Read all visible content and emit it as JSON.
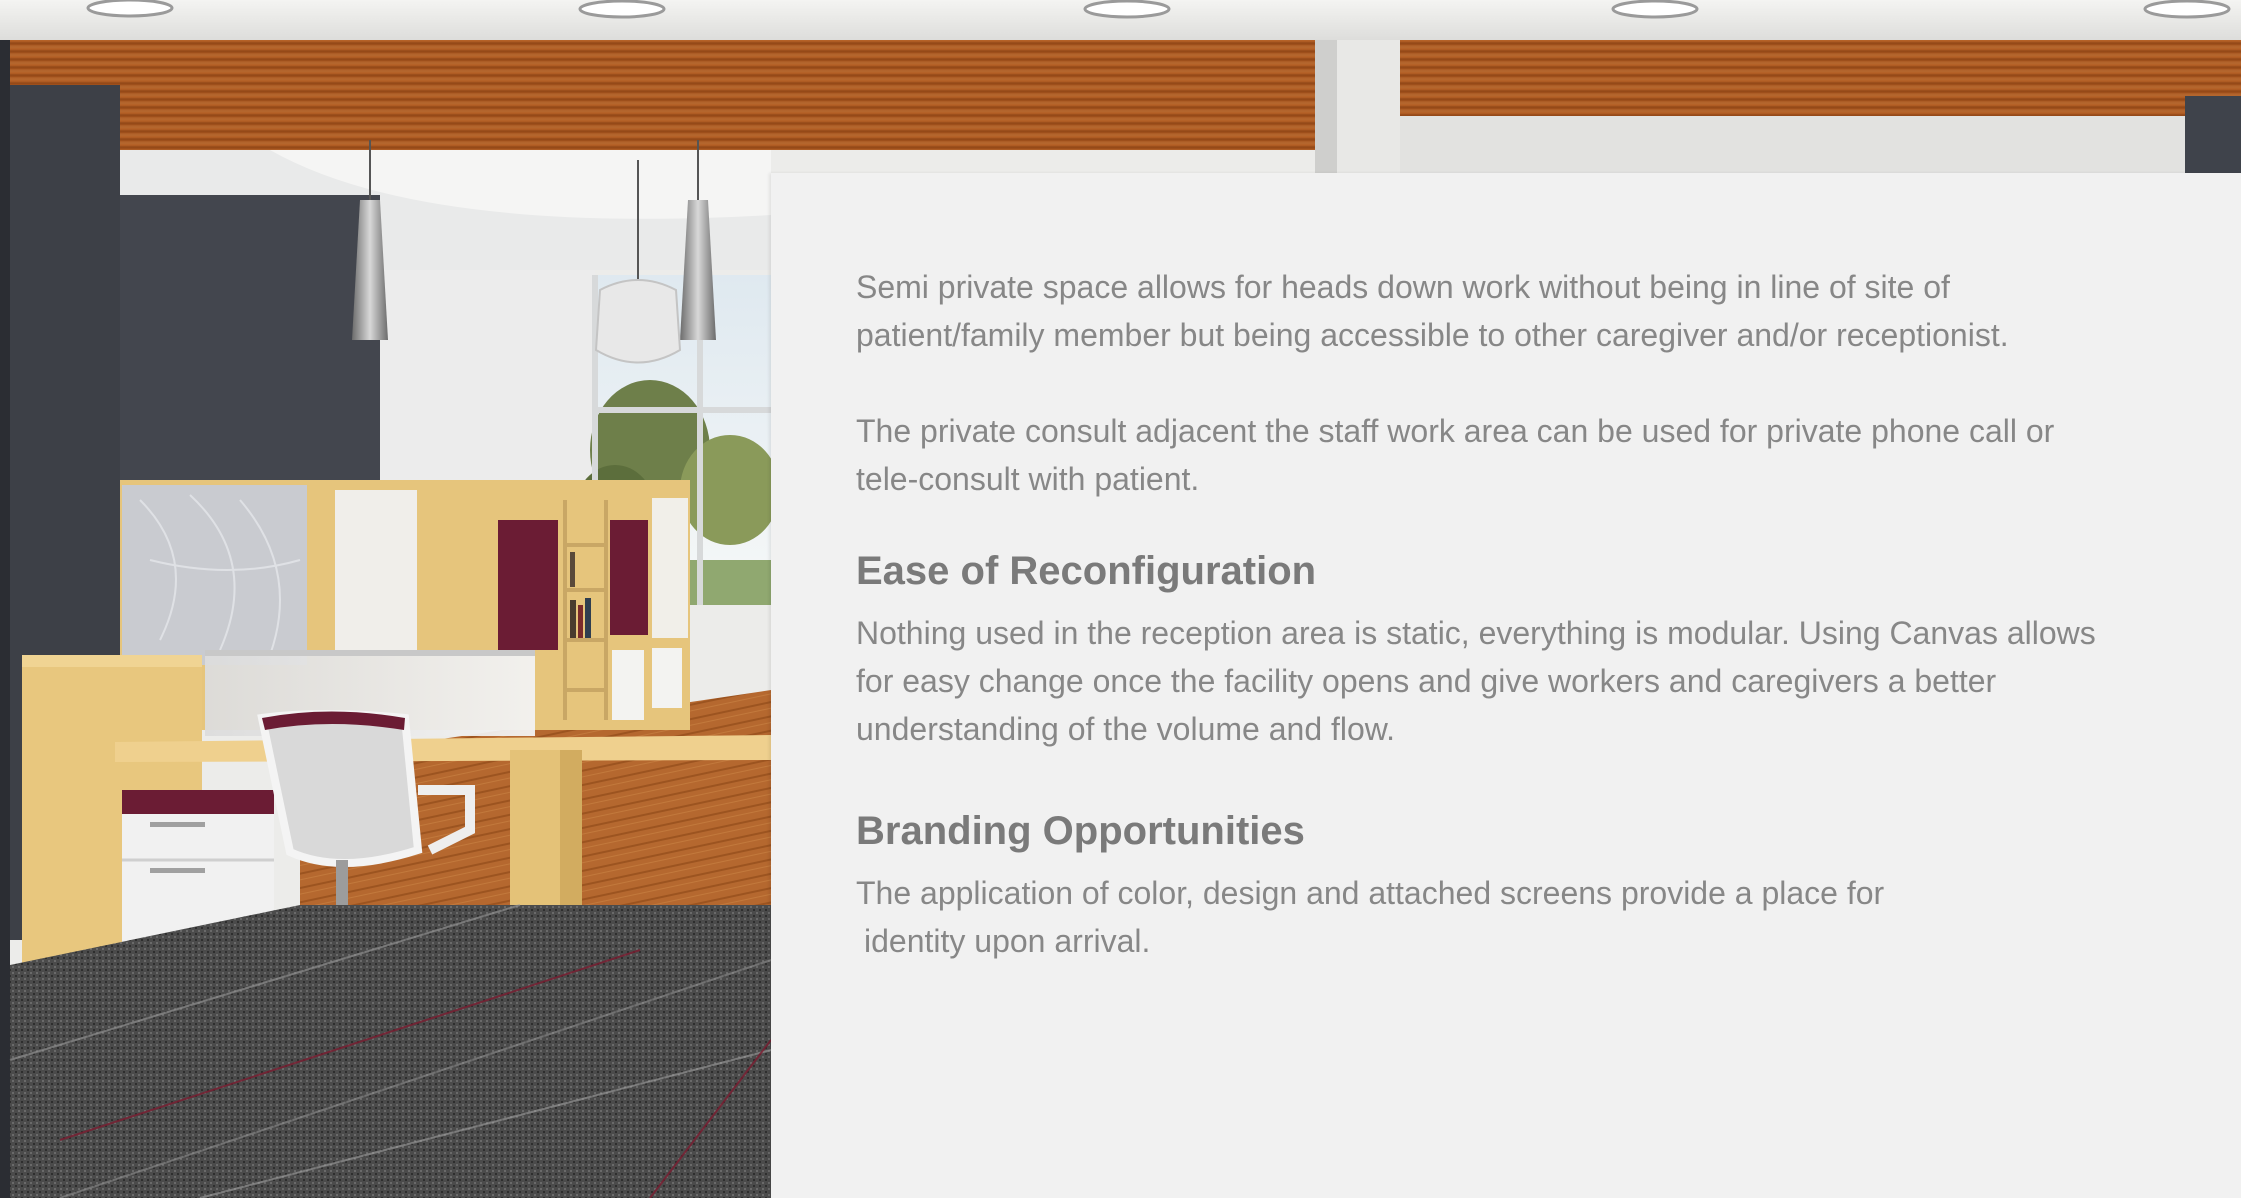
{
  "article": {
    "paragraph_1": "Semi private space allows for heads down work without being in line of site of patient/family member but being accessible to other caregiver and/or receptionist.",
    "paragraph_2": "The private consult adjacent the staff work area can be used for private phone call or tele-consult with patient.",
    "section_1": {
      "heading": "Ease of Reconfiguration",
      "body": "Nothing used in the reception area is static, everything is modular. Using Canvas allows for easy change once the facility opens and give workers and caregivers a better understanding of the volume and flow."
    },
    "section_2": {
      "heading": "Branding Opportunities",
      "body_line_1": "The application of color, design and attached screens provide a place for",
      "body_line_2": "identity upon arrival."
    }
  },
  "colors": {
    "panel_background": "#f1f1f1",
    "body_text": "#878787",
    "heading_text": "#7a7a7a",
    "wood": "#a9581f",
    "wall_dark": "#3d4047",
    "desk_maple": "#e7c57a",
    "accent_maroon": "#6b1c34",
    "carpet": "#4a4a4a"
  }
}
